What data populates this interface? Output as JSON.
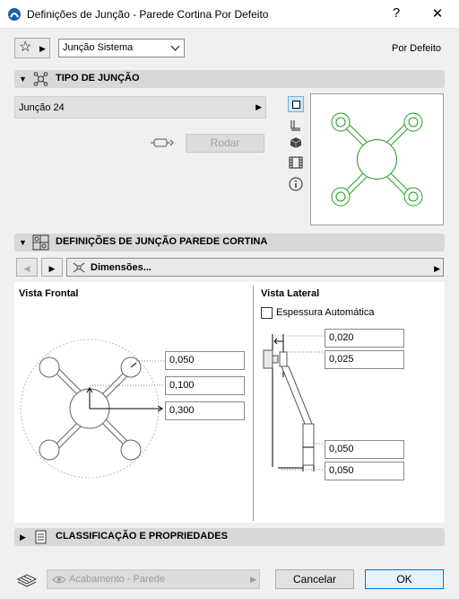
{
  "window": {
    "title": "Definições de Junção - Parede Cortina Por Defeito",
    "help_glyph": "?",
    "close_glyph": "✕"
  },
  "top": {
    "favorite_glyph": "☆",
    "system_dropdown": "Junção Sistema",
    "default_label": "Por Defeito"
  },
  "joint_type": {
    "section_title": "TIPO DE JUNÇÃO",
    "selected": "Junção 24",
    "rotate_button": "Rodar"
  },
  "cw_settings": {
    "section_title": "DEFINIÇÕES DE JUNÇÃO PAREDE CORTINA",
    "page_dropdown": "Dimensões...",
    "front_view_title": "Vista Frontal",
    "side_view_title": "Vista Lateral",
    "auto_thickness_label": "Espessura Automática",
    "front_fields": [
      "0,050",
      "0,100",
      "0,300"
    ],
    "side_fields": [
      "0,020",
      "0,025",
      "0,050",
      "0,050"
    ]
  },
  "classification": {
    "section_title": "CLASSIFICAÇÃO E PROPRIEDADES"
  },
  "footer": {
    "layer": "Acabamento - Parede",
    "cancel": "Cancelar",
    "ok": "OK"
  },
  "colors": {
    "preview_green": "#20a020",
    "primary_border": "#0078d7"
  }
}
